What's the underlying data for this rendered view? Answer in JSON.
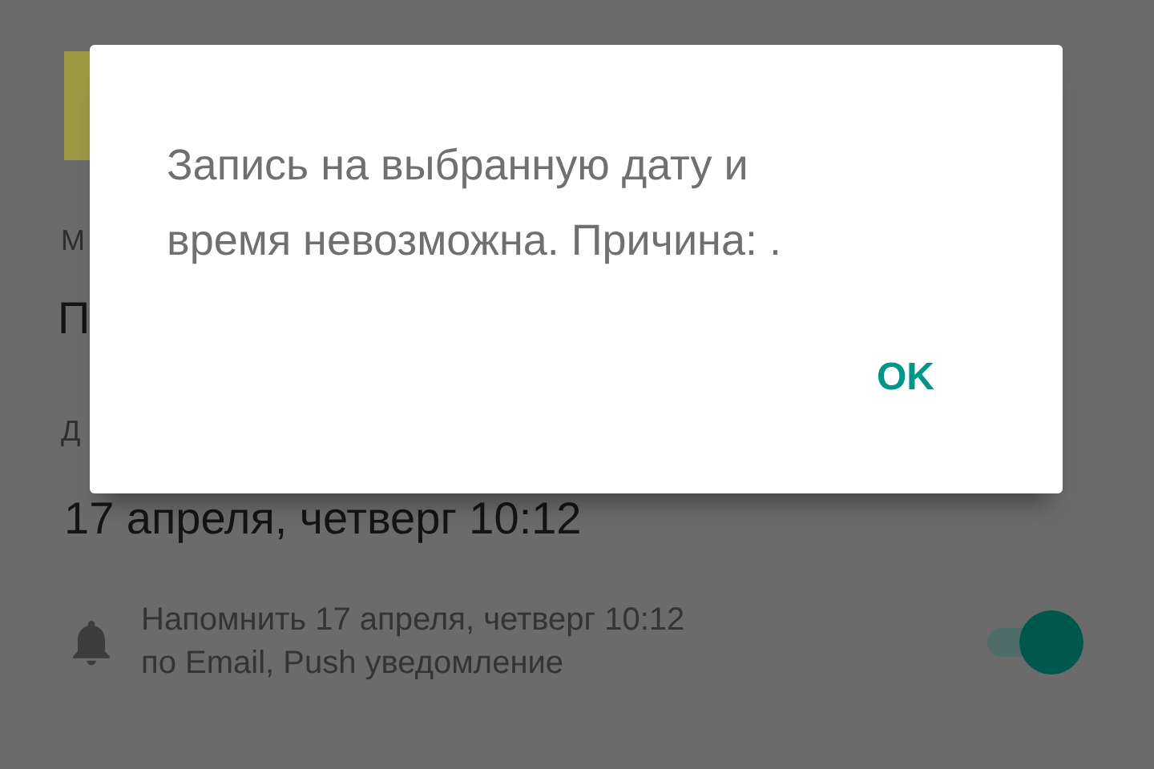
{
  "form": {
    "field_1_label": "М",
    "field_1_value": "П",
    "field_2_label": "Д",
    "field_2_value": "17 апреля, четверг 10:12"
  },
  "reminder": {
    "text": "Напомнить 17 апреля, четверг 10:12",
    "channels": "по Email, Push уведомление",
    "on": true
  },
  "dialog": {
    "message": "Запись на выбранную дату и время невозможна. Причина: .",
    "buttons": [
      "OK"
    ]
  }
}
